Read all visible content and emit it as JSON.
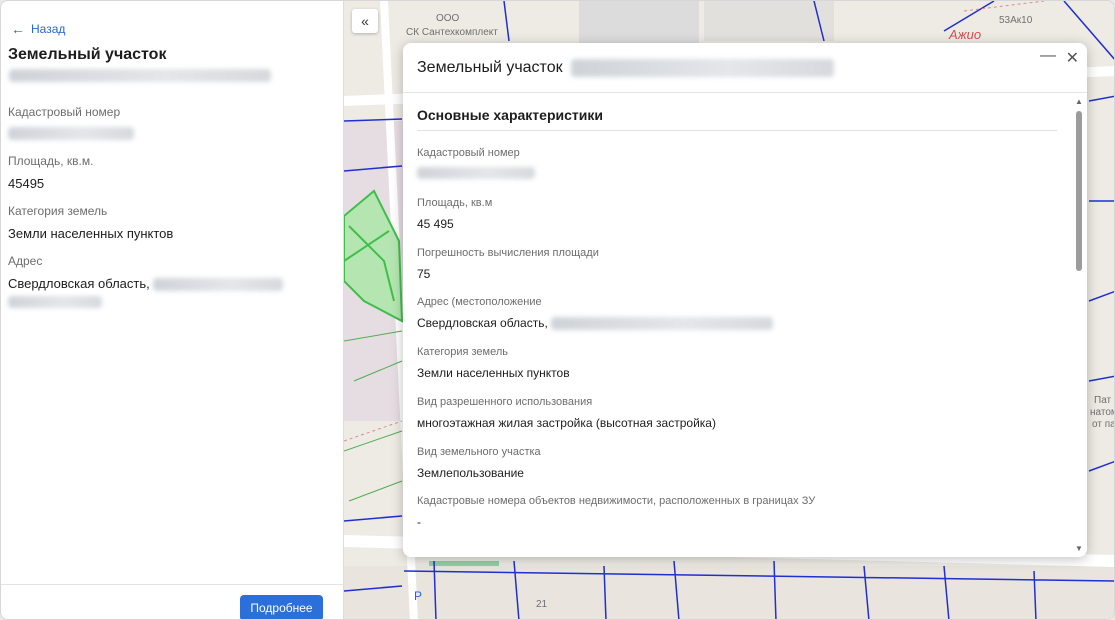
{
  "left_panel": {
    "back_label": "Назад",
    "title": "Земельный участок",
    "fields": [
      {
        "label": "Кадастровый номер",
        "value": ""
      },
      {
        "label": "Площадь, кв.м.",
        "value": "45495"
      },
      {
        "label": "Категория земель",
        "value": "Земли населенных пунктов"
      },
      {
        "label": "Адрес",
        "value": "Свердловская область,"
      }
    ],
    "more_button": "Подробнее"
  },
  "map": {
    "collapse_label": "«",
    "labels": {
      "ooo": "ООО",
      "santeh": "СК Сантехкомплект",
      "brand": "Ажио",
      "number": "53Ак10",
      "right1": "Пат",
      "right2": "натом",
      "right3": "от па",
      "p_sign": "P",
      "num21": "21"
    }
  },
  "modal": {
    "title": "Земельный участок",
    "minimize": "—",
    "close": "✕",
    "section_title": "Основные характеристики",
    "fields": [
      {
        "label": "Кадастровый номер",
        "value": ""
      },
      {
        "label": "Площадь, кв.м",
        "value": "45 495"
      },
      {
        "label": "Погрешность вычисления площади",
        "value": "75"
      },
      {
        "label": "Адрес (местоположение",
        "value": "Свердловская область,"
      },
      {
        "label": "Категория земель",
        "value": "Земли населенных пунктов"
      },
      {
        "label": "Вид разрешенного использования",
        "value": "многоэтажная жилая застройка (высотная застройка)"
      },
      {
        "label": "Вид земельного участка",
        "value": "Землепользование"
      },
      {
        "label": "Кадастровые номера объектов недвижимости, расположенных в границах ЗУ",
        "value": "-"
      }
    ],
    "scroll_up": "▲",
    "scroll_down": "▼"
  },
  "colors": {
    "accent": "#2b6fdb",
    "link": "#2a66c9",
    "parcel_green": "#3fbf4a",
    "boundary_blue": "#1f2fd0"
  }
}
